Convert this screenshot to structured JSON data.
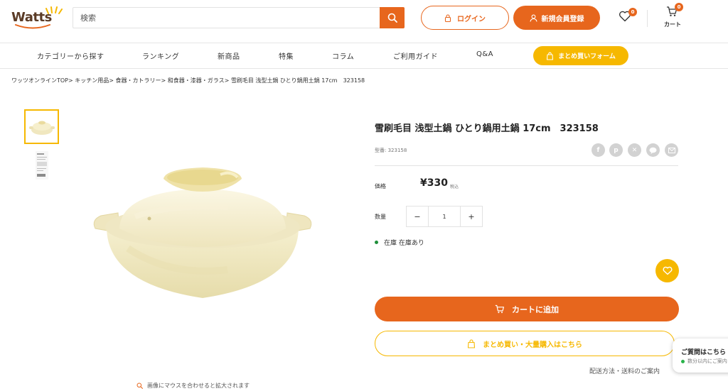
{
  "header": {
    "logo_text": "Watts",
    "search_placeholder": "検索",
    "login_label": "ログイン",
    "register_label": "新規会員登録",
    "favorites_count": "0",
    "cart_count": "0",
    "cart_label": "カート"
  },
  "nav": {
    "items": [
      "カテゴリーから探す",
      "ランキング",
      "新商品",
      "特集",
      "コラム",
      "ご利用ガイド",
      "Q&A"
    ],
    "bulk_form_label": "まとめ買いフォーム"
  },
  "breadcrumb": "ワッツオンラインTOP> キッチン用品> 食器・カトラリー> 和食器・漆器・ガラス> 雪刷毛目 浅型土鍋 ひとり鍋用土鍋 17cm　323158",
  "gallery": {
    "zoom_hint": "画像にマウスを合わせると拡大されます"
  },
  "product": {
    "title": "雪刷毛目 浅型土鍋 ひとり鍋用土鍋 17cm　323158",
    "sku": "型番: 323158",
    "price_label": "価格",
    "price": "¥330",
    "tax_label": "税込",
    "quantity_label": "数量",
    "quantity_minus": "−",
    "quantity_plus": "+",
    "quantity_value": "1",
    "stock_text": "在庫 在庫あり",
    "add_to_cart_label": "カートに追加",
    "bulk_purchase_label": "まとめ買い・大量購入はこちら",
    "shipping_link": "配送方法・送料のご案内"
  },
  "share_icons": [
    "facebook-icon",
    "pinterest-icon",
    "x-icon",
    "line-icon",
    "mail-icon"
  ],
  "chat": {
    "title": "ご質問はこちら",
    "subtitle": "数分以内にご案内"
  },
  "colors": {
    "accent_orange": "#e7661d",
    "accent_yellow": "#f6b800",
    "stock_green": "#1f8f3a"
  }
}
